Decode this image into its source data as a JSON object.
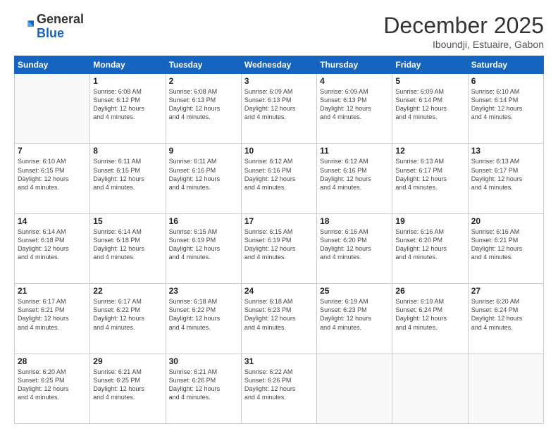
{
  "header": {
    "logo_line1": "General",
    "logo_line2": "Blue",
    "month": "December 2025",
    "location": "Iboundji, Estuaire, Gabon"
  },
  "weekdays": [
    "Sunday",
    "Monday",
    "Tuesday",
    "Wednesday",
    "Thursday",
    "Friday",
    "Saturday"
  ],
  "weeks": [
    [
      {
        "day": "",
        "info": ""
      },
      {
        "day": "1",
        "info": "Sunrise: 6:08 AM\nSunset: 6:12 PM\nDaylight: 12 hours\nand 4 minutes."
      },
      {
        "day": "2",
        "info": "Sunrise: 6:08 AM\nSunset: 6:13 PM\nDaylight: 12 hours\nand 4 minutes."
      },
      {
        "day": "3",
        "info": "Sunrise: 6:09 AM\nSunset: 6:13 PM\nDaylight: 12 hours\nand 4 minutes."
      },
      {
        "day": "4",
        "info": "Sunrise: 6:09 AM\nSunset: 6:13 PM\nDaylight: 12 hours\nand 4 minutes."
      },
      {
        "day": "5",
        "info": "Sunrise: 6:09 AM\nSunset: 6:14 PM\nDaylight: 12 hours\nand 4 minutes."
      },
      {
        "day": "6",
        "info": "Sunrise: 6:10 AM\nSunset: 6:14 PM\nDaylight: 12 hours\nand 4 minutes."
      }
    ],
    [
      {
        "day": "7",
        "info": "Sunrise: 6:10 AM\nSunset: 6:15 PM\nDaylight: 12 hours\nand 4 minutes."
      },
      {
        "day": "8",
        "info": "Sunrise: 6:11 AM\nSunset: 6:15 PM\nDaylight: 12 hours\nand 4 minutes."
      },
      {
        "day": "9",
        "info": "Sunrise: 6:11 AM\nSunset: 6:16 PM\nDaylight: 12 hours\nand 4 minutes."
      },
      {
        "day": "10",
        "info": "Sunrise: 6:12 AM\nSunset: 6:16 PM\nDaylight: 12 hours\nand 4 minutes."
      },
      {
        "day": "11",
        "info": "Sunrise: 6:12 AM\nSunset: 6:16 PM\nDaylight: 12 hours\nand 4 minutes."
      },
      {
        "day": "12",
        "info": "Sunrise: 6:13 AM\nSunset: 6:17 PM\nDaylight: 12 hours\nand 4 minutes."
      },
      {
        "day": "13",
        "info": "Sunrise: 6:13 AM\nSunset: 6:17 PM\nDaylight: 12 hours\nand 4 minutes."
      }
    ],
    [
      {
        "day": "14",
        "info": "Sunrise: 6:14 AM\nSunset: 6:18 PM\nDaylight: 12 hours\nand 4 minutes."
      },
      {
        "day": "15",
        "info": "Sunrise: 6:14 AM\nSunset: 6:18 PM\nDaylight: 12 hours\nand 4 minutes."
      },
      {
        "day": "16",
        "info": "Sunrise: 6:15 AM\nSunset: 6:19 PM\nDaylight: 12 hours\nand 4 minutes."
      },
      {
        "day": "17",
        "info": "Sunrise: 6:15 AM\nSunset: 6:19 PM\nDaylight: 12 hours\nand 4 minutes."
      },
      {
        "day": "18",
        "info": "Sunrise: 6:16 AM\nSunset: 6:20 PM\nDaylight: 12 hours\nand 4 minutes."
      },
      {
        "day": "19",
        "info": "Sunrise: 6:16 AM\nSunset: 6:20 PM\nDaylight: 12 hours\nand 4 minutes."
      },
      {
        "day": "20",
        "info": "Sunrise: 6:16 AM\nSunset: 6:21 PM\nDaylight: 12 hours\nand 4 minutes."
      }
    ],
    [
      {
        "day": "21",
        "info": "Sunrise: 6:17 AM\nSunset: 6:21 PM\nDaylight: 12 hours\nand 4 minutes."
      },
      {
        "day": "22",
        "info": "Sunrise: 6:17 AM\nSunset: 6:22 PM\nDaylight: 12 hours\nand 4 minutes."
      },
      {
        "day": "23",
        "info": "Sunrise: 6:18 AM\nSunset: 6:22 PM\nDaylight: 12 hours\nand 4 minutes."
      },
      {
        "day": "24",
        "info": "Sunrise: 6:18 AM\nSunset: 6:23 PM\nDaylight: 12 hours\nand 4 minutes."
      },
      {
        "day": "25",
        "info": "Sunrise: 6:19 AM\nSunset: 6:23 PM\nDaylight: 12 hours\nand 4 minutes."
      },
      {
        "day": "26",
        "info": "Sunrise: 6:19 AM\nSunset: 6:24 PM\nDaylight: 12 hours\nand 4 minutes."
      },
      {
        "day": "27",
        "info": "Sunrise: 6:20 AM\nSunset: 6:24 PM\nDaylight: 12 hours\nand 4 minutes."
      }
    ],
    [
      {
        "day": "28",
        "info": "Sunrise: 6:20 AM\nSunset: 6:25 PM\nDaylight: 12 hours\nand 4 minutes."
      },
      {
        "day": "29",
        "info": "Sunrise: 6:21 AM\nSunset: 6:25 PM\nDaylight: 12 hours\nand 4 minutes."
      },
      {
        "day": "30",
        "info": "Sunrise: 6:21 AM\nSunset: 6:26 PM\nDaylight: 12 hours\nand 4 minutes."
      },
      {
        "day": "31",
        "info": "Sunrise: 6:22 AM\nSunset: 6:26 PM\nDaylight: 12 hours\nand 4 minutes."
      },
      {
        "day": "",
        "info": ""
      },
      {
        "day": "",
        "info": ""
      },
      {
        "day": "",
        "info": ""
      }
    ]
  ]
}
